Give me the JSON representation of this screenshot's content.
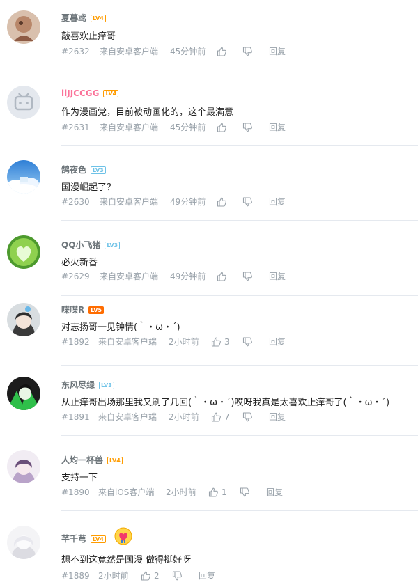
{
  "comments": [
    {
      "username": "夏暮鸢",
      "level": "LV4",
      "text": "敲喜欢止痒哥",
      "floor": "#2632",
      "source": "来自安卓客户端",
      "time": "45分钟前",
      "likes": "",
      "reply": "回复"
    },
    {
      "username": "llJJCCGG",
      "level": "LV4",
      "text": "作为漫画党，目前被动画化的，这个最满意",
      "floor": "#2631",
      "source": "来自安卓客户端",
      "time": "45分钟前",
      "likes": "",
      "reply": "回复"
    },
    {
      "username": "鹄夜色",
      "level": "LV3",
      "text": "国漫崛起了？",
      "floor": "#2630",
      "source": "来自安卓客户端",
      "time": "49分钟前",
      "likes": "",
      "reply": "回复"
    },
    {
      "username": "QQ小飞猪",
      "level": "LV3",
      "text": "必火新番",
      "floor": "#2629",
      "source": "来自安卓客户端",
      "time": "49分钟前",
      "likes": "",
      "reply": "回复"
    },
    {
      "username": "喋喋R",
      "level": "LV5",
      "text": "对志扬哥一见钟情(｀・ω・´)",
      "floor": "#1892",
      "source": "来自安卓客户端",
      "time": "2小时前",
      "likes": "3",
      "reply": "回复"
    },
    {
      "username": "东风尽绿",
      "level": "LV3",
      "text": "从止痒哥出场那里我又刷了几回(｀・ω・´)哎呀我真是太喜欢止痒哥了(｀・ω・´)",
      "floor": "#1891",
      "source": "来自安卓客户端",
      "time": "2小时前",
      "likes": "7",
      "reply": "回复"
    },
    {
      "username": "人均一杯兽",
      "level": "LV4",
      "text": "支持一下",
      "floor": "#1890",
      "source": "来自iOS客户端",
      "time": "2小时前",
      "likes": "1",
      "reply": "回复"
    },
    {
      "username": "芊千芎",
      "level": "LV4",
      "text": "想不到这竟然是国漫 做得挺好呀",
      "floor": "#1889",
      "source": "",
      "time": "2小时前",
      "likes": "2",
      "reply": "回复"
    }
  ],
  "icons": {
    "like": "thumbs-up-icon",
    "dislike": "thumbs-down-icon"
  },
  "colors": {
    "username": "#6d757a",
    "username_vip": "#fb7299",
    "meta": "#99a2aa",
    "level_orange": "#ff9c00",
    "level_blue": "#6ec2e7",
    "level_red": "#ff6c00"
  }
}
